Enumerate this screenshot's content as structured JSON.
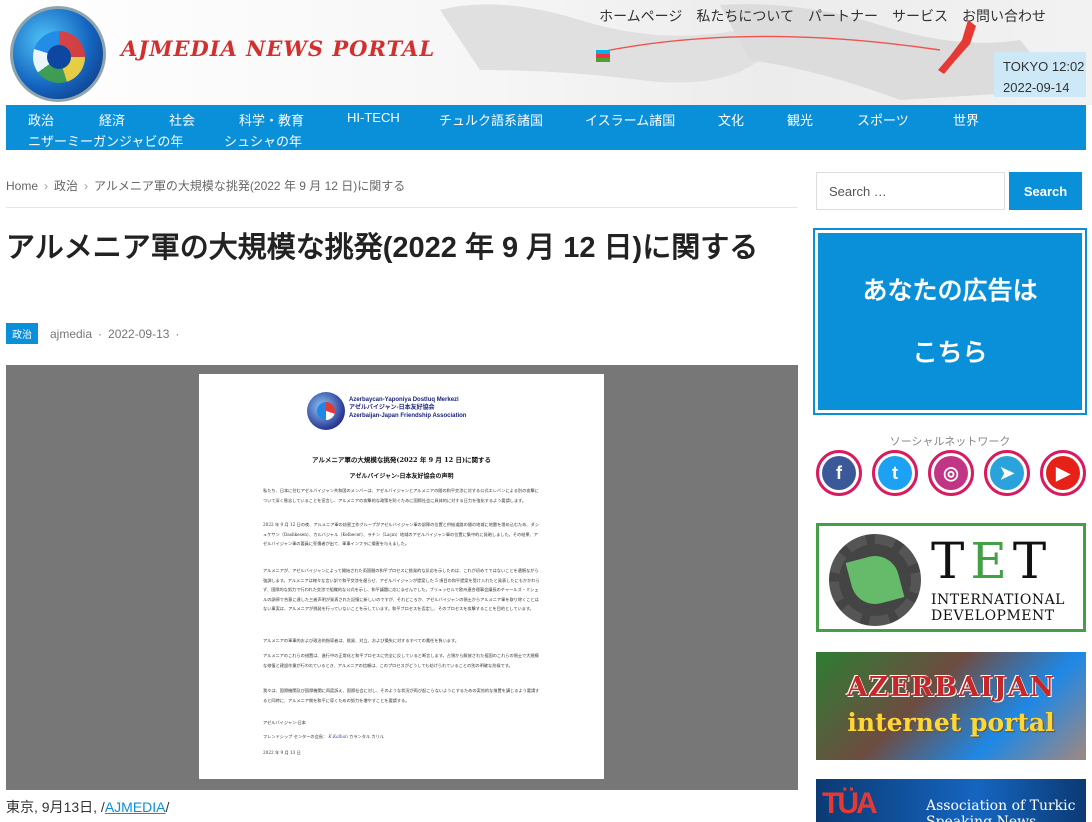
{
  "header": {
    "site_title": "AJMEDIA NEWS PORTAL",
    "top_nav": [
      "ホームページ",
      "私たちについて",
      "パートナー",
      "サービス",
      "お問い合わせ"
    ],
    "clock_city": "TOKYO 12:02",
    "clock_date": "2022-09-14"
  },
  "main_nav": {
    "items": [
      "政治",
      "経済",
      "社会",
      "科学・教育",
      "HI-TECH",
      "チュルク語系諸国",
      "イスラーム諸国",
      "文化",
      "観光",
      "スポーツ",
      "世界",
      "ニザーミーガンジャビの年",
      "シュシャの年"
    ]
  },
  "breadcrumb": {
    "home": "Home",
    "category": "政治",
    "current": "アルメニア軍の大規模な挑発(2022 年 9 月 12 日)に関する"
  },
  "article": {
    "title": "アルメニア軍の大規模な挑発(2022 年 9 月 12 日)に関する",
    "category": "政治",
    "author": "ajmedia",
    "date": "2022-09-13",
    "dot": "·",
    "caption_prefix": "東京, 9月13日, /",
    "caption_link": "AJMEDIA",
    "caption_suffix": "/"
  },
  "document": {
    "org_line1": "Azerbaycan-Yaponiya Dostluq Merkezi",
    "org_line2": "アゼルバイジャン-日本友好協会",
    "org_line3": "Azerbaijan-Japan Friendship Association",
    "title": "アルメニア軍の大規模な挑発(2022 年 9 月 12 日)に関する",
    "subtitle": "アゼルバイジャン-日本友好協会の声明",
    "para1": "私たち、日本に住むアゼルバイジャン共和国のメンバーは、アゼルバイジャンとアルメニアの間の和平交渉に対する公式エレバンによる別の攻撃について深く懸念していることを宣言し、アルメニアの攻撃的な政策を防ぐために国際社会に具体的に対する圧力を強化するよう要請します。",
    "para2": "2022 年 9 月 12 日の夜、アルメニア軍の妨害工作グループがアゼルバイジャン軍の部隊の位置と供給道路の間の地域に地雷を埋め込むため、ダシュケサン（Dashkesen）、カルバジャル（Kelbecer）、ラチン（Laçın）地域のアゼルバイジャン軍の位置に集中的に発砲しました。その結果、アゼルバイジャン軍の要員に死傷者が出て、軍事インフラに損害を与えました。",
    "para3": "アルメニアが、アゼルバイジャンによって開始された両国間の和平プロセスに挑発的な反応を示したのは、これが初めてではないことを遺憾ながら強調します。アルメニアは様々な言い訳で和平交渉を遅らせ、アゼルバイジャンが提案した 5 項目の和平提案を受け入れたと発表したにもかかわらず、国際的な努力で行われた交渉で組織的な公式を示し、和平議題に応じませんでした。ブリュッセルで欧州連合理事会議長のチャールズ・ミシェルの調停で合意に達した三者声明が発表された記憶に新しいのですが、それどころか、アゼルバイジャンの領土からアルメニア軍を取り除くことはない事実は、アルメニアが挑発を行っていないことを示しています。和平プロセスを否定し、そのプロセスを攻撃することを目的としています。",
    "para4": "アルメニアの軍事的および政治的指導者は、挑発、対立、および損失に対するすべての責任を負います。",
    "para5": "アルメニアのこれらの措置は、進行中の正常化と和平プロセスに完全に反していると断言します。占領から解放された祖国のこれらの領土で大規模な修復と建設作業が行われているとき、アルメニアの信頼は、このプロセスがどうしても妨げられていることの別の明確な兆候です。",
    "para6": "我々は、国際機関及び国際機関に再度訴え、国際社会に対し、そのような状況が再び起こらないようにするための実効的な措置を講じるよう要請すると同時に、アルメニア側を和平に導くための努力を増やすことを要請する。",
    "sign1": "アゼルバイジャン-日本",
    "sign2_label": "フレンドシップ センターの会長：",
    "sign2_mark": "K.Kalbalı",
    "sign2_name": "カランタル カリル",
    "sign3": "2022 年 9 月 13 日"
  },
  "sidebar": {
    "search_placeholder": "Search …",
    "search_button": "Search",
    "ad_line1": "あなたの広告は",
    "ad_line2": "こちら",
    "social_title": "ソーシャルネットワーク",
    "social": [
      {
        "name": "facebook",
        "glyph": "f",
        "color": "#3b5998"
      },
      {
        "name": "twitter",
        "glyph": "t",
        "color": "#1da1f2"
      },
      {
        "name": "instagram",
        "glyph": "◎",
        "color": "#c13584"
      },
      {
        "name": "telegram",
        "glyph": "➤",
        "color": "#2aa3dc"
      },
      {
        "name": "youtube",
        "glyph": "▶",
        "color": "#e62117"
      }
    ],
    "tet_big_1": "T",
    "tet_big_2": "E",
    "tet_big_3": "T",
    "tet_sub1": "INTERNATIONAL",
    "tet_sub2": "DEVELOPMENT",
    "az_title": "AZERBAIJAN",
    "az_sub": "internet portal",
    "ats_logo": "TÜA",
    "ats_line1": "Association of Turkic",
    "ats_line2": "Speaking News Agencies"
  },
  "colors": {
    "accent": "#0a8fd9",
    "brand_red": "#d32f2f",
    "clock_bg": "#cde9f7"
  }
}
